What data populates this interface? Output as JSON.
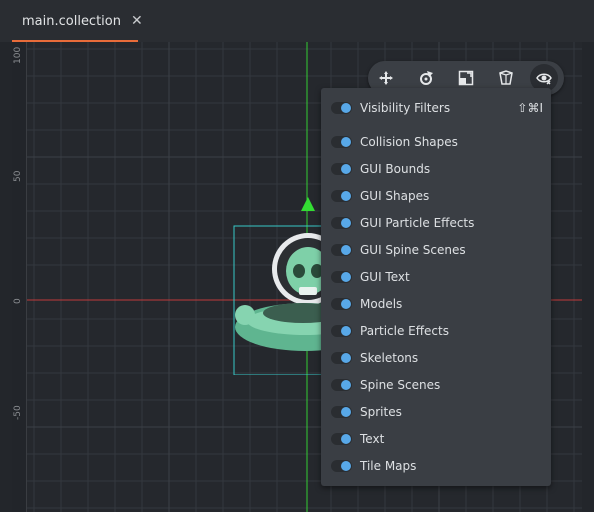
{
  "tab": {
    "title": "main.collection",
    "close": "✕"
  },
  "rulers": {
    "labels": [
      "100",
      "50",
      "0",
      "-50"
    ]
  },
  "toolbar": {
    "tools": [
      "move-icon",
      "rotate-icon",
      "scale-icon",
      "perspective-icon",
      "visibility-icon"
    ],
    "active": "visibility-icon"
  },
  "menu": {
    "header": {
      "label": "Visibility Filters",
      "shortcut": "⇧⌘I"
    },
    "items": [
      "Collision Shapes",
      "GUI Bounds",
      "GUI Shapes",
      "GUI Particle Effects",
      "GUI Spine Scenes",
      "GUI Text",
      "Models",
      "Particle Effects",
      "Skeletons",
      "Spine Scenes",
      "Sprites",
      "Text",
      "Tile Maps"
    ]
  },
  "colors": {
    "accent_tab": "#e86c3a",
    "toggle_on": "#58a8e8",
    "x_axis": "#c03a3a",
    "y_axis": "#33cc33",
    "selection": "#37c7c7"
  }
}
